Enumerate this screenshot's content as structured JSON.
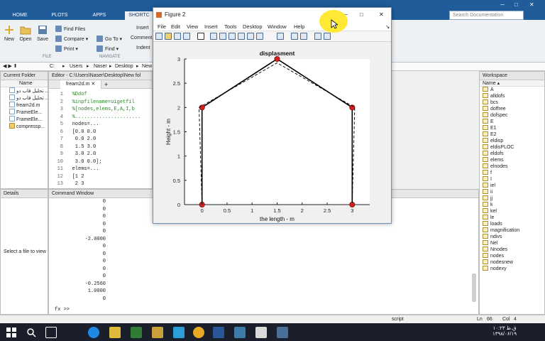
{
  "matlab": {
    "tabs": [
      "HOME",
      "PLOTS",
      "APPS",
      "SHORTC"
    ],
    "search_placeholder": "Search Documentation",
    "ribbon": {
      "new": "New",
      "open": "Open",
      "save": "Save",
      "find_files": "Find Files",
      "compare": "Compare",
      "print": "Print",
      "go_to": "Go To",
      "find": "Find",
      "insert": "Insert",
      "comment": "Comment",
      "indent": "Indent",
      "group_file": "FILE",
      "group_navigate": "NAVIGATE"
    },
    "address": [
      "C:",
      "Users",
      "Naser",
      "Desktop",
      "New"
    ],
    "current_folder": {
      "title": "Current Folder",
      "name_header": "Name",
      "files": [
        "تحلیل قاب دو ...",
        "تحلیل قاب دو ...",
        "fream2d.m",
        "FrameEle...",
        "FrameEle...",
        "compressp..."
      ]
    },
    "details": {
      "title": "Details",
      "empty": "Select a file to view"
    },
    "editor": {
      "title": "Editor - C:\\Users\\Naser\\Desktop\\New fol",
      "tab": "fream2d.m",
      "lines": [
        {
          "n": "1",
          "t": "%Ddof"
        },
        {
          "n": "2",
          "t": "%inpfilename=uigetfil"
        },
        {
          "n": "3",
          "t": "%[nodes,elems,E,A,I,b"
        },
        {
          "n": "4",
          "t": "%......................"
        },
        {
          "n": "5",
          "t": "nodes=..."
        },
        {
          "n": "6",
          "t": "[0.0 0.0"
        },
        {
          "n": "7",
          "t": " 0.0 2.0"
        },
        {
          "n": "8",
          "t": " 1.5 3.0"
        },
        {
          "n": "9",
          "t": " 3.0 2.0"
        },
        {
          "n": "10",
          "t": " 3.0 0.0];"
        },
        {
          "n": "11",
          "t": "elems=..."
        },
        {
          "n": "12",
          "t": "[1 2"
        },
        {
          "n": "13",
          "t": " 2 3"
        }
      ]
    },
    "command": {
      "title": "Command Window",
      "values": [
        "0",
        "0",
        "0",
        "0",
        "0",
        "-2.0000",
        "0",
        "0",
        "0",
        "0",
        "0",
        "-0.2560",
        "1.0000",
        "0"
      ],
      "prompt": ">>"
    },
    "workspace": {
      "title": "Workspace",
      "name_header": "Name",
      "vars": [
        "A",
        "alldofs",
        "bcs",
        "doffree",
        "dofspec",
        "E",
        "E1",
        "E2",
        "eldisp",
        "eldisPLOC",
        "eldofs",
        "elems",
        "elnodes",
        "f",
        "I",
        "iel",
        "ii",
        "jj",
        "k",
        "kel",
        "le",
        "loads",
        "magnification",
        "ndivs",
        "Nel",
        "Nnodes",
        "nodes",
        "nodesnew",
        "nodexy"
      ]
    },
    "status": {
      "script": "script",
      "ln": "Ln",
      "ln_val": "66",
      "col": "Col",
      "col_val": "4"
    }
  },
  "figure": {
    "title": "Figure 2",
    "menu": [
      "File",
      "Edit",
      "View",
      "Insert",
      "Tools",
      "Desktop",
      "Window",
      "Help"
    ]
  },
  "taskbar": {
    "time": "ق.ظ ۱۰:۲۳",
    "date": "۱۳۹۸/۰۶/۱۹"
  },
  "chart_data": {
    "type": "line",
    "title": "displasment",
    "xlabel": "the length - m",
    "ylabel": "Height - m",
    "xlim": [
      -0.35,
      3.35
    ],
    "ylim": [
      0,
      3
    ],
    "xticks": [
      "0",
      "0.5",
      "1",
      "1.5",
      "2",
      "2.5",
      "3"
    ],
    "yticks": [
      "0",
      "0.5",
      "1",
      "1.5",
      "2",
      "2.5",
      "3"
    ],
    "grid": false,
    "series": [
      {
        "style": "solid",
        "color": "#000000",
        "markers": "red-circle",
        "x": [
          0.0,
          0.0,
          1.5,
          3.0,
          3.0
        ],
        "y": [
          0.0,
          2.0,
          3.0,
          2.0,
          0.0
        ]
      },
      {
        "style": "dashed",
        "color": "#000000",
        "x": [
          0.0,
          -0.06,
          1.5,
          3.05,
          3.0
        ],
        "y": [
          0.0,
          2.0,
          2.92,
          2.0,
          0.0
        ]
      }
    ]
  }
}
